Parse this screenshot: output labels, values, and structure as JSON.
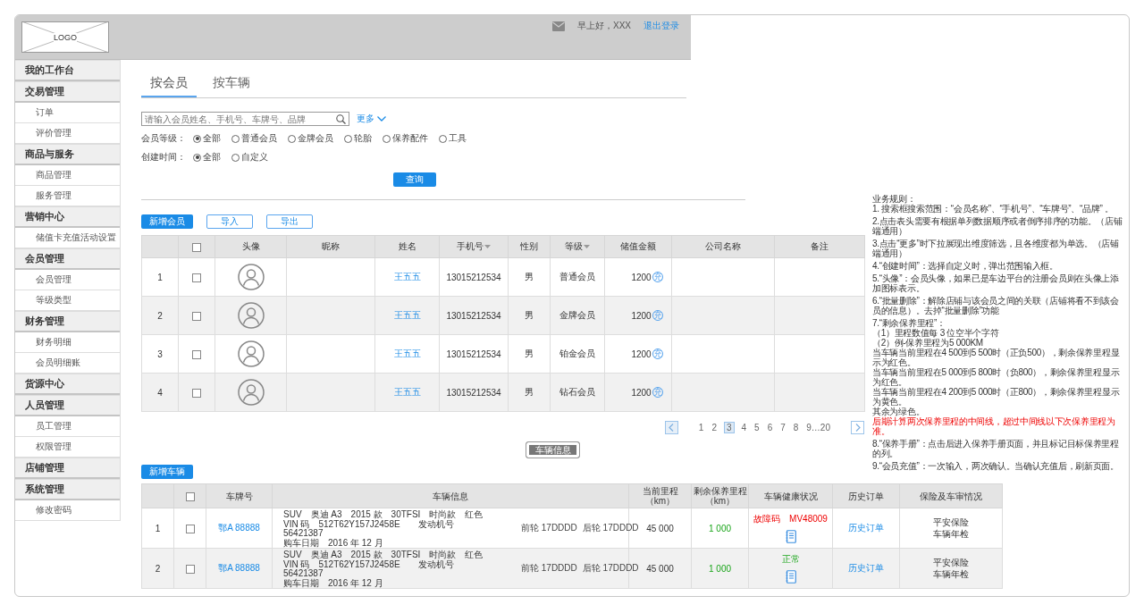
{
  "header": {
    "logo": "LOGO",
    "greeting": "早上好，XXX",
    "logout": "退出登录"
  },
  "sidebar": {
    "items": [
      {
        "label": "我的工作台"
      },
      {
        "label": "交易管理",
        "children": [
          {
            "label": "订单"
          },
          {
            "label": "评价管理"
          }
        ]
      },
      {
        "label": "商品与服务",
        "children": [
          {
            "label": "商品管理"
          },
          {
            "label": "服务管理"
          }
        ]
      },
      {
        "label": "营销中心",
        "children": [
          {
            "label": "储值卡充值活动设置"
          }
        ]
      },
      {
        "label": "会员管理",
        "children": [
          {
            "label": "会员管理"
          },
          {
            "label": "等级类型"
          }
        ]
      },
      {
        "label": "财务管理",
        "children": [
          {
            "label": "财务明细"
          },
          {
            "label": "会员明细账"
          }
        ]
      },
      {
        "label": "货源中心"
      },
      {
        "label": "人员管理",
        "children": [
          {
            "label": "员工管理"
          },
          {
            "label": "权限管理"
          }
        ]
      },
      {
        "label": "店铺管理"
      },
      {
        "label": "系统管理",
        "children": [
          {
            "label": "修改密码"
          }
        ]
      }
    ]
  },
  "tabs": [
    {
      "label": "按会员",
      "selected": true
    },
    {
      "label": "按车辆",
      "selected": false
    }
  ],
  "search": {
    "placeholder": "请输入会员姓名、手机号、车牌号、品牌",
    "more": "更多"
  },
  "filters": [
    {
      "label": "会员等级：",
      "options": [
        {
          "label": "全部",
          "selected": true
        },
        {
          "label": "普通会员",
          "selected": false
        },
        {
          "label": "金牌会员",
          "selected": false
        },
        {
          "label": "轮胎",
          "selected": false
        },
        {
          "label": "保养配件",
          "selected": false
        },
        {
          "label": "工具",
          "selected": false
        }
      ]
    },
    {
      "label": "创建时间：",
      "options": [
        {
          "label": "全部",
          "selected": true
        },
        {
          "label": "自定义",
          "selected": false
        }
      ]
    }
  ],
  "query_button": "查询",
  "member_actions": {
    "add": "新增会员",
    "import": "导入",
    "export": "导出"
  },
  "member_table": {
    "select_all": false,
    "columns": [
      {
        "label": "头像",
        "sortable": false
      },
      {
        "label": "昵称",
        "sortable": false
      },
      {
        "label": "姓名",
        "sortable": false
      },
      {
        "label": "手机号",
        "sortable": true
      },
      {
        "label": "性别",
        "sortable": false
      },
      {
        "label": "等级",
        "sortable": true
      },
      {
        "label": "储值金额",
        "sortable": false
      },
      {
        "label": "公司名称",
        "sortable": false
      },
      {
        "label": "备注",
        "sortable": false
      }
    ],
    "rows": [
      {
        "index": "1",
        "checked": false,
        "name": "王五五",
        "phone": "13015212534",
        "gender": "男",
        "level": "普通会员",
        "balance": "1200",
        "recharge": "充"
      },
      {
        "index": "2",
        "checked": false,
        "name": "王五五",
        "phone": "13015212534",
        "gender": "男",
        "level": "金牌会员",
        "balance": "1200",
        "recharge": "充"
      },
      {
        "index": "3",
        "checked": false,
        "name": "王五五",
        "phone": "13015212534",
        "gender": "男",
        "level": "铂金会员",
        "balance": "1200",
        "recharge": "充"
      },
      {
        "index": "4",
        "checked": false,
        "name": "王五五",
        "phone": "13015212534",
        "gender": "男",
        "level": "钻石会员",
        "balance": "1200",
        "recharge": "充"
      }
    ]
  },
  "pagination": {
    "pages": [
      {
        "label": "1",
        "selected": false
      },
      {
        "label": "2",
        "selected": false
      },
      {
        "label": "3",
        "selected": true
      },
      {
        "label": "4",
        "selected": false
      },
      {
        "label": "5",
        "selected": false
      },
      {
        "label": "6",
        "selected": false
      },
      {
        "label": "7",
        "selected": false
      },
      {
        "label": "8",
        "selected": false
      },
      {
        "label": "9…20",
        "selected": false
      }
    ]
  },
  "notes": {
    "title": "业务规则：",
    "items": [
      {
        "lines": [
          {
            "text": "1. 搜索框搜索范围：“会员名称”、“手机号”、“车牌号”、“品牌” 。",
            "kind": "plain"
          }
        ]
      },
      {
        "lines": [
          {
            "text": "2.点击表头需要有根据单列数据顺序或者倒序排序的功能。（店铺端通用）",
            "kind": "plain"
          }
        ]
      },
      {
        "lines": [
          {
            "text": "3.点击“更多”时下拉展现出维度筛选，且各维度都为单选。（店铺端通用）",
            "kind": "plain"
          }
        ]
      },
      {
        "lines": [
          {
            "text": "4.“创建时间”：选择自定义时，弹出范围输入框。",
            "kind": "plain"
          }
        ]
      },
      {
        "lines": [
          {
            "text": "5.“头像”：会员头像，如果已是车边平台的注册会员则在头像上添加图标表示。",
            "kind": "plain"
          }
        ]
      },
      {
        "lines": [
          {
            "text": "6.“批量删除”：解除店铺与该会员之间的关联（店铺将看不到该会员的信息）。去掉“批量删除”功能",
            "kind": "plain"
          }
        ]
      },
      {
        "lines": [
          {
            "text": "7.“剩余保养里程”：",
            "kind": "plain"
          },
          {
            "text": "（1）里程数值每 3 位空半个字符",
            "kind": "plain"
          },
          {
            "text": "（2）例-保养里程为5 000KM",
            "kind": "plain"
          },
          {
            "text": "当车辆当前里程在4 500到5 500时（正负500），剩余保养里程显示为红色。",
            "kind": "plain"
          },
          {
            "text": "当车辆当前里程在5 000到5 800时（负800），剩余保养里程显示为红色。",
            "kind": "plain"
          },
          {
            "text": "当车辆当前里程在4 200到5 000时（正800），剩余保养里程显示为黄色。",
            "kind": "plain"
          },
          {
            "text": "其余为绿色。",
            "kind": "plain"
          },
          {
            "text": "后期计算两次保养里程的中间线，超过中间线以下次保养里程为准。",
            "kind": "alert"
          }
        ]
      },
      {
        "lines": [
          {
            "text": "8.“保养手册”：点击后进入保养手册页面，并且标记目标保养里程的列。",
            "kind": "plain"
          }
        ]
      },
      {
        "lines": [
          {
            "text": "9.“会员充值”：一次输入，两次确认。当确认充值后，刷新页面。",
            "kind": "plain"
          }
        ]
      }
    ]
  },
  "vehicle_toggle": "车辆信息",
  "vehicle_actions": {
    "add": "新增车辆"
  },
  "vehicle_table": {
    "select_all": false,
    "columns": [
      "车牌号",
      "车辆信息",
      "当前里程（km）",
      "剩余保养里程（km）",
      "车辆健康状况",
      "历史订单",
      "保险及车审情况"
    ],
    "rows": [
      {
        "index": "1",
        "checked": false,
        "plate": "鄂A 88888",
        "info_lines": [
          "SUV　奥迪 A3　2015 款　30TFSI　时尚款　红色",
          "VIN 码　512T62Y157J2458E　　发动机号",
          "56421387",
          "购车日期　2016 年 12 月"
        ],
        "front_tire": "前轮 17DDDD",
        "rear_tire": "后轮 17DDDD",
        "mileage": "45 000",
        "remaining": "1 000",
        "health": {
          "kind": "fault",
          "text": "故障码　MV48009"
        },
        "history": "历史订单",
        "insurance": [
          "平安保险",
          "车辆年检"
        ]
      },
      {
        "index": "2",
        "checked": false,
        "plate": "鄂A 88888",
        "info_lines": [
          "SUV　奥迪 A3　2015 款　30TFSI　时尚款　红色",
          "VIN 码　512T62Y157J2458E　　发动机号",
          "56421387",
          "购车日期　2016 年 12 月"
        ],
        "front_tire": "前轮 17DDDD",
        "rear_tire": "后轮 17DDDD",
        "mileage": "45 000",
        "remaining": "1 000",
        "health": {
          "kind": "normal",
          "text": "正常"
        },
        "history": "历史订单",
        "insurance": [
          "平安保险",
          "车辆年检"
        ]
      }
    ]
  }
}
